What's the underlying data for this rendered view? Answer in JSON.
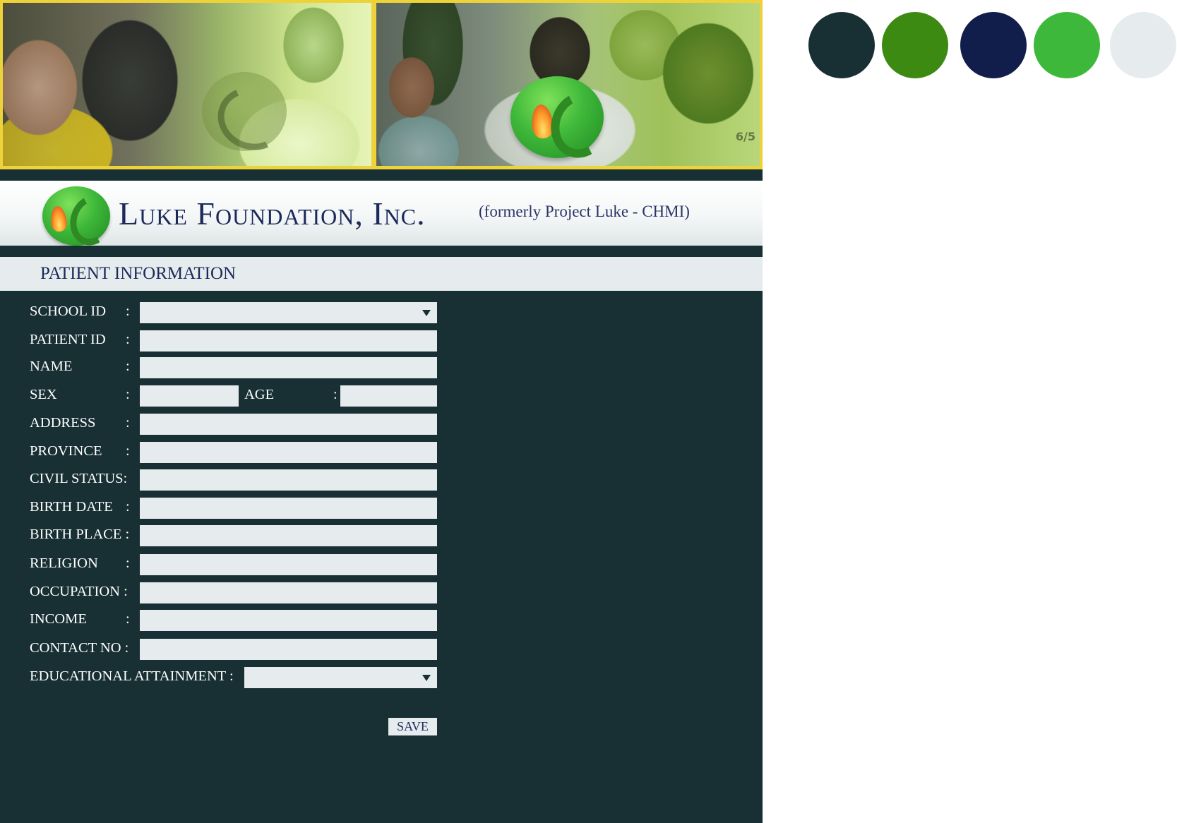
{
  "banner": {
    "photo_counter": "6/5"
  },
  "brand": {
    "name": "Luke Foundation, Inc.",
    "subtitle": "(formerly Project Luke - CHMI)"
  },
  "section": {
    "title": "PATIENT INFORMATION"
  },
  "form": {
    "school_id": {
      "label": "SCHOOL ID",
      "colon": ":",
      "value": ""
    },
    "patient_id": {
      "label": "PATIENT ID",
      "colon": ":",
      "value": ""
    },
    "name": {
      "label": "NAME",
      "colon": ":",
      "value": ""
    },
    "sex": {
      "label": "SEX",
      "colon": ":",
      "value": ""
    },
    "age": {
      "label": "AGE",
      "colon": ":",
      "value": ""
    },
    "address": {
      "label": "ADDRESS",
      "colon": ":",
      "value": ""
    },
    "province": {
      "label": "PROVINCE",
      "colon": ":",
      "value": ""
    },
    "civil_status": {
      "label": "CIVIL STATUS:",
      "value": ""
    },
    "birth_date": {
      "label": "BIRTH DATE",
      "colon": ":",
      "value": ""
    },
    "birth_place": {
      "label": "BIRTH PLACE :",
      "value": ""
    },
    "religion": {
      "label": "RELIGION",
      "colon": ":",
      "value": ""
    },
    "occupation": {
      "label": "OCCUPATION :",
      "value": ""
    },
    "income": {
      "label": "INCOME",
      "colon": ":",
      "value": ""
    },
    "contact_no": {
      "label": "CONTACT NO :",
      "value": ""
    },
    "educational_attainment": {
      "label": "EDUCATIONAL ATTAINMENT :",
      "value": ""
    },
    "save_label": "SAVE"
  },
  "palette": {
    "colors": [
      "#183034",
      "#3d8a12",
      "#111d4a",
      "#3db83a",
      "#e6ecee"
    ]
  }
}
